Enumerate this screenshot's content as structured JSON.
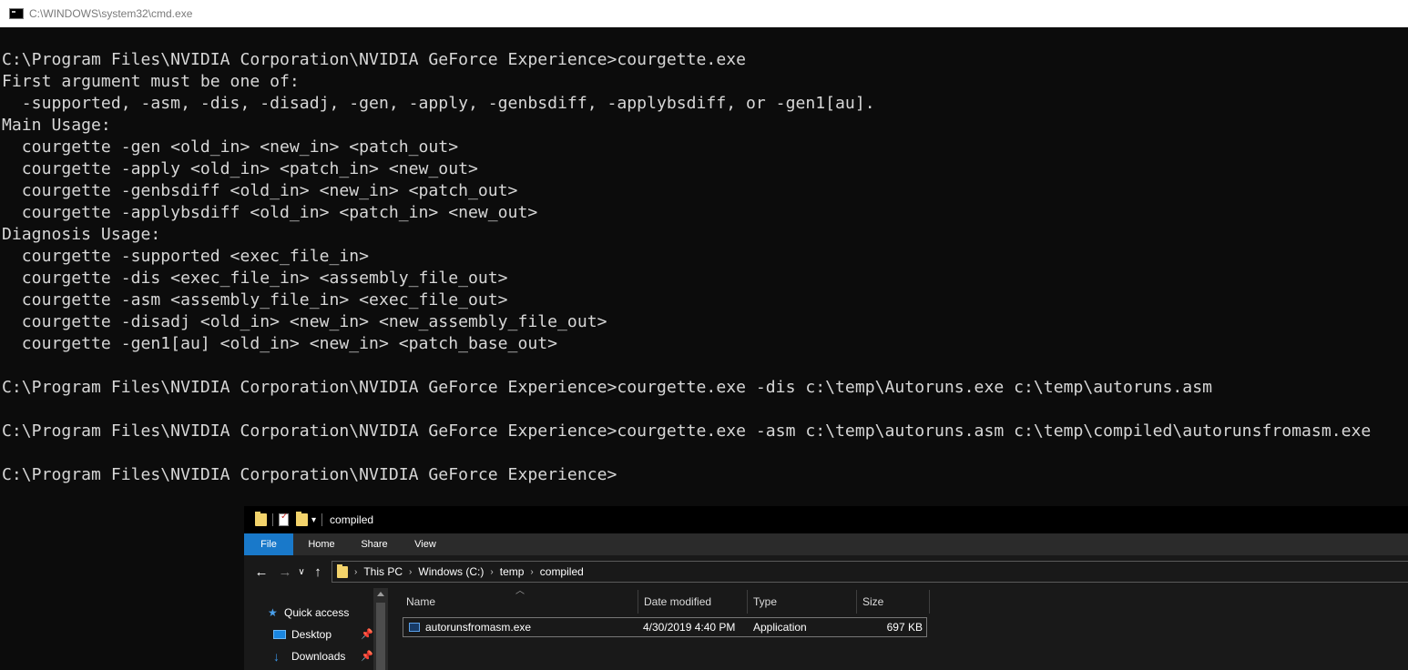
{
  "cmd_window": {
    "title": "C:\\WINDOWS\\system32\\cmd.exe",
    "text_color": "#d7d7d7",
    "background": "#0c0c0c",
    "lines": [
      "C:\\Program Files\\NVIDIA Corporation\\NVIDIA GeForce Experience>courgette.exe",
      "First argument must be one of:",
      "  -supported, -asm, -dis, -disadj, -gen, -apply, -genbsdiff, -applybsdiff, or -gen1[au].",
      "Main Usage:",
      "  courgette -gen <old_in> <new_in> <patch_out>",
      "  courgette -apply <old_in> <patch_in> <new_out>",
      "  courgette -genbsdiff <old_in> <new_in> <patch_out>",
      "  courgette -applybsdiff <old_in> <patch_in> <new_out>",
      "Diagnosis Usage:",
      "  courgette -supported <exec_file_in>",
      "  courgette -dis <exec_file_in> <assembly_file_out>",
      "  courgette -asm <assembly_file_in> <exec_file_out>",
      "  courgette -disadj <old_in> <new_in> <new_assembly_file_out>",
      "  courgette -gen1[au] <old_in> <new_in> <patch_base_out>",
      "",
      "C:\\Program Files\\NVIDIA Corporation\\NVIDIA GeForce Experience>courgette.exe -dis c:\\temp\\Autoruns.exe c:\\temp\\autoruns.asm",
      "",
      "C:\\Program Files\\NVIDIA Corporation\\NVIDIA GeForce Experience>courgette.exe -asm c:\\temp\\autoruns.asm c:\\temp\\compiled\\autorunsfromasm.exe",
      "",
      "C:\\Program Files\\NVIDIA Corporation\\NVIDIA GeForce Experience>"
    ]
  },
  "explorer": {
    "title": "compiled",
    "ribbon_tabs": [
      "File",
      "Home",
      "Share",
      "View"
    ],
    "accent_color": "#1979ca",
    "breadcrumb": [
      "This PC",
      "Windows (C:)",
      "temp",
      "compiled"
    ],
    "nav": {
      "quick_access": "Quick access",
      "desktop": "Desktop",
      "downloads": "Downloads"
    },
    "columns": [
      "Name",
      "Date modified",
      "Type",
      "Size"
    ],
    "files": [
      {
        "name": "autorunsfromasm.exe",
        "date_modified": "4/30/2019 4:40 PM",
        "type": "Application",
        "size": "697 KB"
      }
    ],
    "icons": {
      "back": "arrow-left-icon",
      "forward": "arrow-right-icon",
      "recent": "chevron-down-icon",
      "up": "arrow-up-icon",
      "quick_access": "star-icon",
      "pin": "pin-icon"
    }
  }
}
